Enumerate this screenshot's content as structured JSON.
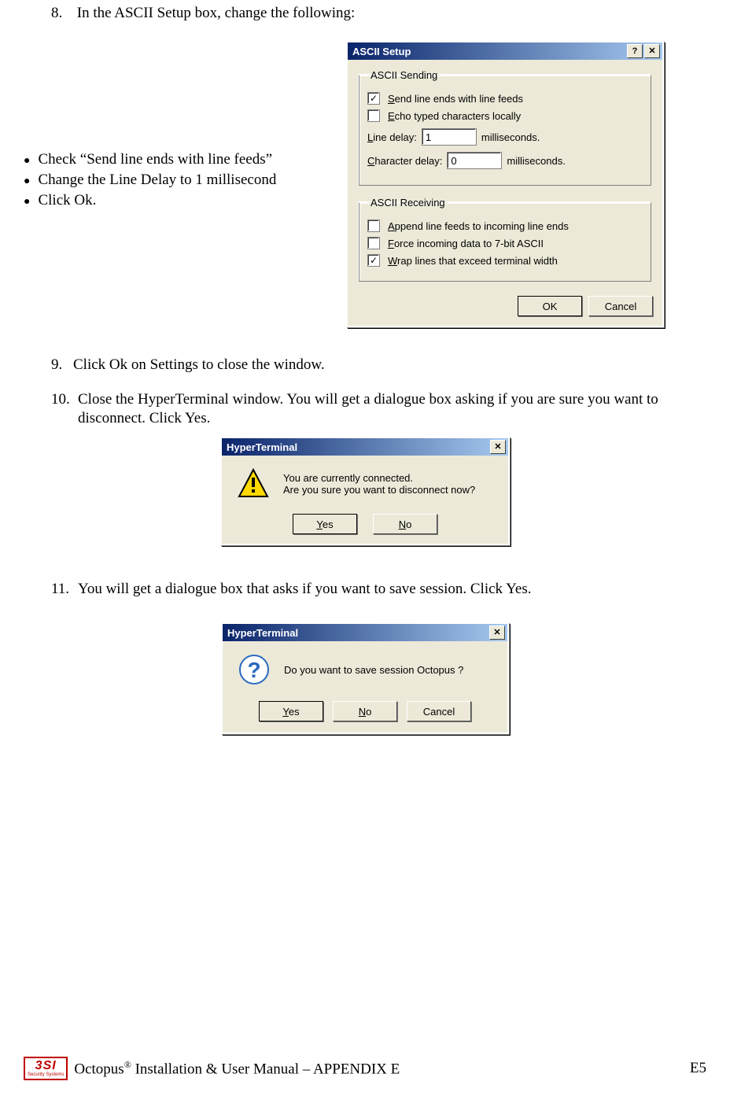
{
  "step8": {
    "num": "8.",
    "text": "In the ASCII Setup box, change the following:"
  },
  "bullets": [
    "Check “Send line ends with line feeds”",
    "Change the Line Delay to 1 millisecond",
    "Click Ok."
  ],
  "ascii_dialog": {
    "title": "ASCII Setup",
    "help_btn": "?",
    "close_btn": "✕",
    "group_sending": "ASCII Sending",
    "chk_send_line_ends": "Send line ends with line feeds",
    "chk_send_prefix": "S",
    "chk_echo": "Echo typed characters locally",
    "chk_echo_prefix": "E",
    "line_delay_label_pre": "L",
    "line_delay_label": "ine delay:",
    "line_delay_value": "1",
    "line_delay_unit": "milliseconds.",
    "char_delay_label_pre": "C",
    "char_delay_label": "haracter delay:",
    "char_delay_value": "0",
    "char_delay_unit": "milliseconds.",
    "group_receiving": "ASCII Receiving",
    "chk_append": "Append line feeds to incoming line ends",
    "chk_append_prefix": "A",
    "chk_force": "Force incoming data to 7-bit ASCII",
    "chk_force_prefix": "F",
    "chk_wrap": "Wrap lines that exceed terminal width",
    "chk_wrap_prefix": "W",
    "ok": "OK",
    "cancel": "Cancel"
  },
  "step9": {
    "num": "9.",
    "text": "Click Ok on Settings to close the window."
  },
  "step10": {
    "num": "10.",
    "text": "Close the HyperTerminal window. You will get a dialogue box asking if you are sure you want to disconnect. Click Yes."
  },
  "ht_dialog1": {
    "title": "HyperTerminal",
    "close_btn": "✕",
    "line1": "You are currently connected.",
    "line2": "Are you sure you want to disconnect now?",
    "yes": "Yes",
    "yes_prefix": "Y",
    "no": "No",
    "no_prefix": "N"
  },
  "step11": {
    "num": "11.",
    "text": "You will get a dialogue box that asks if you want to save session. Click Yes."
  },
  "ht_dialog2": {
    "title": "HyperTerminal",
    "close_btn": "✕",
    "msg": "Do you want to save session Octopus ?",
    "yes": "Yes",
    "yes_prefix": "Y",
    "no": "No",
    "no_prefix": "N",
    "cancel": "Cancel"
  },
  "footer": {
    "logo_top": "3SI",
    "logo_bot": "Security Systems",
    "title_pre": "Octopus",
    "reg": "®",
    "title_post": " Installation & User Manual – APPENDIX E",
    "page": "E5"
  }
}
